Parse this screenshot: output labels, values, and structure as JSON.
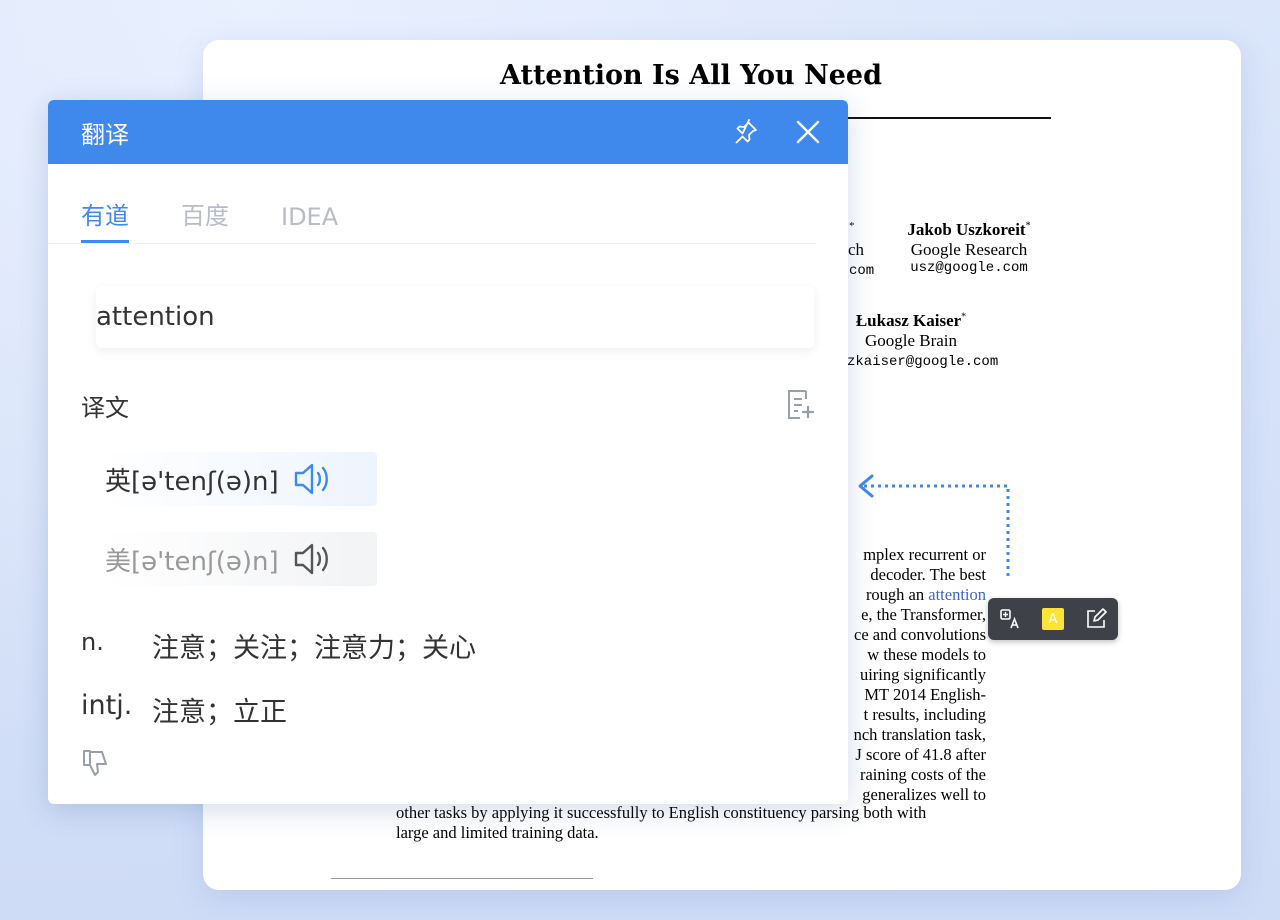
{
  "pdf": {
    "title": "Attention Is All You Need",
    "authors": [
      {
        "name_frag": "*",
        "aff_frag": "ch",
        "mail_frag": "com"
      },
      {
        "name": "Jakob Uszkoreit",
        "mark": "*",
        "aff": "Google Research",
        "mail": "usz@google.com"
      },
      {
        "name": "Łukasz Kaiser",
        "mark": "*",
        "aff": "Google Brain",
        "mail_frag": "zkaiser@google.com"
      }
    ],
    "abstract_lines": [
      {
        "text": "mplex recurrent or"
      },
      {
        "text": "decoder.  The best"
      },
      {
        "pre": "rough an ",
        "hl": "attention"
      },
      {
        "text": "e, the Transformer,"
      },
      {
        "text": "ce and convolutions"
      },
      {
        "text": "w these models to"
      },
      {
        "text": "uiring significantly"
      },
      {
        "text": "MT 2014 English-"
      },
      {
        "text": "t results, including"
      },
      {
        "text": "nch translation task,"
      },
      {
        "text": "J score of 41.8 after"
      },
      {
        "text": "raining costs of the"
      },
      {
        "text": "generalizes well to"
      }
    ],
    "abstract_full": [
      "other tasks by applying it successfully to English constituency parsing both with",
      "large and limited training data."
    ]
  },
  "toolbar": {
    "translate_icon": "translate-icon",
    "highlight_icon": "highlight-icon",
    "highlight_letter": "A",
    "note_icon": "edit-note-icon",
    "highlight_color": "#fde333"
  },
  "panel": {
    "title": "翻译",
    "pin_icon": "pin-icon",
    "close_icon": "close-icon",
    "tabs": [
      {
        "label": "有道",
        "active": true
      },
      {
        "label": "百度",
        "active": false
      },
      {
        "label": "IDEA",
        "active": false
      }
    ],
    "query": "attention",
    "section_label": "译文",
    "copy_icon": "copy-to-note-icon",
    "pron_uk": "英[ə'tenʃ(ə)n]",
    "pron_us": "美[ə'tenʃ(ə)n]",
    "definitions": [
      {
        "pos": "n.",
        "meaning": "注意；关注；注意力；关心"
      },
      {
        "pos": "intj.",
        "meaning": "注意；立正"
      }
    ],
    "feedback_icon": "thumbs-down-icon"
  },
  "colors": {
    "accent": "#3f88ec",
    "toolbar_bg": "#3e4147",
    "link_highlight": "#3d66c4"
  }
}
